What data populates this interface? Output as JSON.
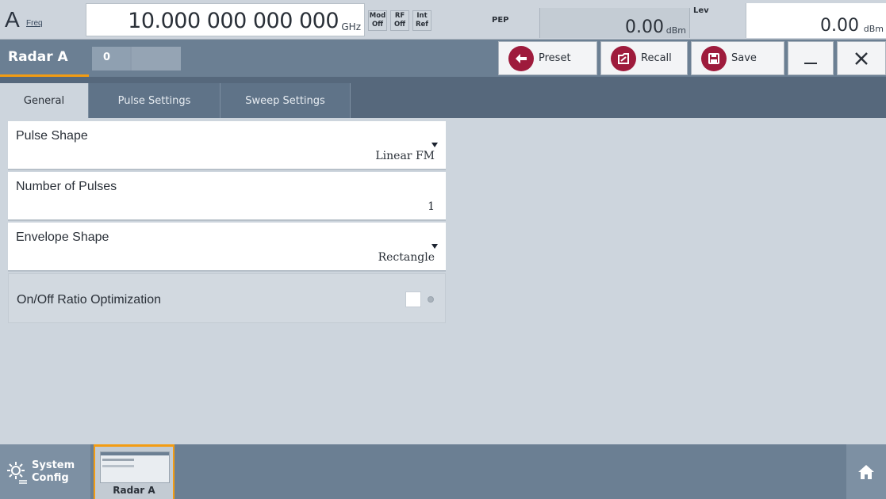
{
  "topbar": {
    "channel": "A",
    "freq_label": "Freq",
    "freq_value": "10.000 000 000 000",
    "freq_unit": "GHz",
    "indicators": [
      {
        "top": "Mod",
        "bottom": "Off"
      },
      {
        "top": "RF",
        "bottom": "Off"
      },
      {
        "top": "Int",
        "bottom": "Ref"
      }
    ],
    "pep_label": "PEP",
    "pep_value": "0.00",
    "pep_unit": "dBm",
    "level_label": "Lev",
    "level_value": "0.00",
    "level_unit": "dBm"
  },
  "titlebar": {
    "title": "Radar A",
    "slider_value": "0",
    "preset_label": "Preset",
    "recall_label": "Recall",
    "save_label": "Save"
  },
  "tabs": [
    {
      "label": "General",
      "active": true
    },
    {
      "label": "Pulse Settings",
      "active": false
    },
    {
      "label": "Sweep Settings",
      "active": false
    }
  ],
  "settings": {
    "pulse_shape": {
      "label": "Pulse Shape",
      "value": "Linear FM"
    },
    "number_of_pulses": {
      "label": "Number of Pulses",
      "value": "1"
    },
    "envelope_shape": {
      "label": "Envelope Shape",
      "value": "Rectangle"
    },
    "onoff_ratio": {
      "label": "On/Off Ratio Optimization",
      "checked": false
    }
  },
  "taskbar": {
    "system_config_line1": "System",
    "system_config_line2": "Config",
    "radar_label": "Radar A"
  },
  "colors": {
    "accent": "#f39c12",
    "button_icon": "#9e1b3c",
    "titlebar": "#6b7f93",
    "tabbar": "#56687c"
  }
}
